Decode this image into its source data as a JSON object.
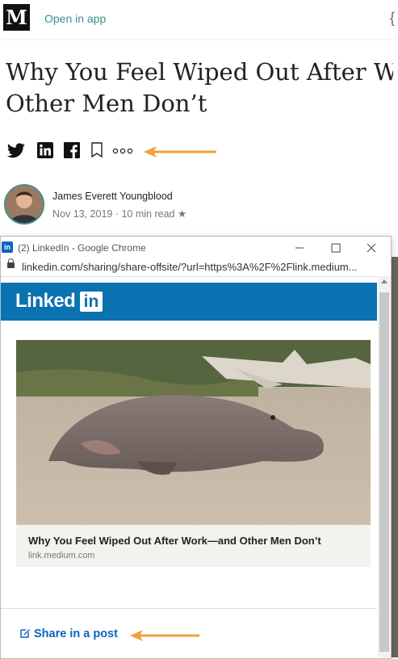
{
  "header": {
    "logo": "M",
    "open_in_app": "Open in app",
    "right_glyph": "{"
  },
  "article": {
    "title_line1": "Why You Feel Wiped Out After Work –",
    "title_line2": "Other Men Don’t",
    "author": "James Everett Youngblood",
    "meta": "Nov 13, 2019 · 10 min read ★"
  },
  "share_icons": [
    "twitter-icon",
    "linkedin-icon",
    "facebook-icon",
    "bookmark-icon",
    "more-icon"
  ],
  "popup": {
    "badge": "in",
    "window_title": "(2) LinkedIn - Google Chrome",
    "url": "linkedin.com/sharing/share-offsite/?url=https%3A%2F%2Flink.medium...",
    "brand_word": "Linked",
    "brand_in": "in",
    "card_title": "Why You Feel Wiped Out After Work—and Other Men Don’t",
    "card_domain": "link.medium.com",
    "share_button": "Share in a post"
  },
  "colors": {
    "accent_arrow": "#f2a13a",
    "linkedin_blue": "#0a72b0",
    "link_blue": "#0a66c2"
  }
}
